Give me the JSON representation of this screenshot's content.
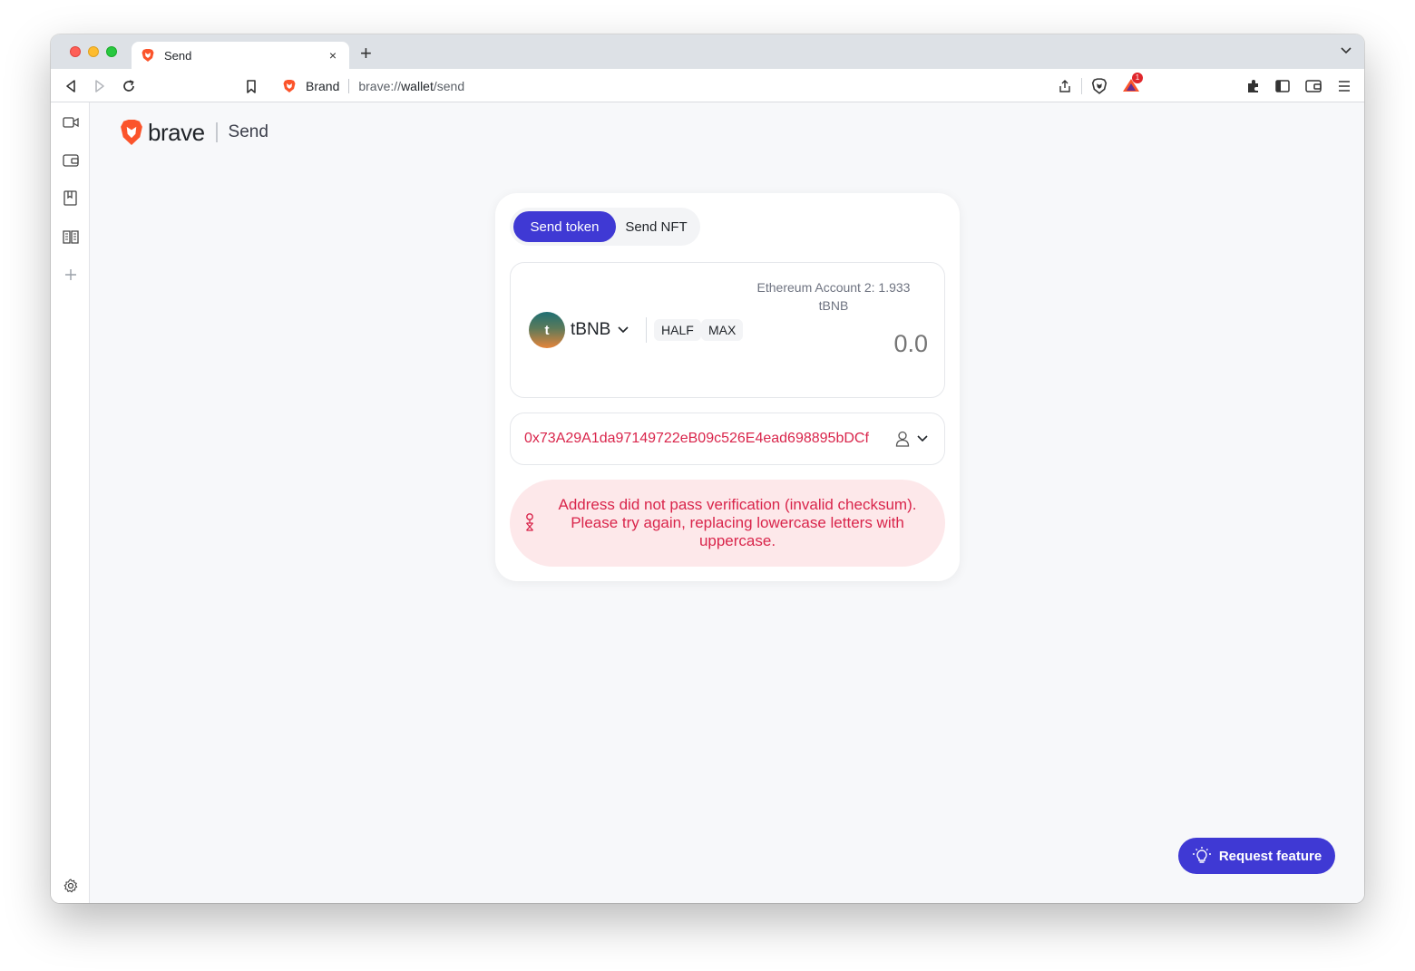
{
  "browser": {
    "tab": {
      "title": "Send",
      "close_glyph": "×"
    },
    "new_tab_glyph": "+",
    "omnibox": {
      "brand": "Brand",
      "url_prefix": "brave://",
      "url_host": "wallet",
      "url_path": "/send"
    },
    "rewards_badge": "1"
  },
  "header": {
    "logo_word": "brave",
    "page_title": "Send"
  },
  "send": {
    "tabs": [
      {
        "label": "Send token",
        "active": true
      },
      {
        "label": "Send NFT",
        "active": false
      }
    ],
    "balance_line1": "Ethereum Account 2: 1.933",
    "balance_line2": "tBNB",
    "token": {
      "letter": "t",
      "symbol": "tBNB"
    },
    "half_label": "HALF",
    "max_label": "MAX",
    "amount_placeholder": "0.0",
    "to_address": "0x73A29A1da97149722eB09c526E4ead698895bDCf",
    "error_message": "Address did not pass verification (invalid checksum). Please try again, replacing lowercase letters with uppercase."
  },
  "request_feature_label": "Request feature",
  "colors": {
    "accent": "#3f39d4",
    "error": "#d9254b",
    "error_bg": "#fde8ea"
  }
}
